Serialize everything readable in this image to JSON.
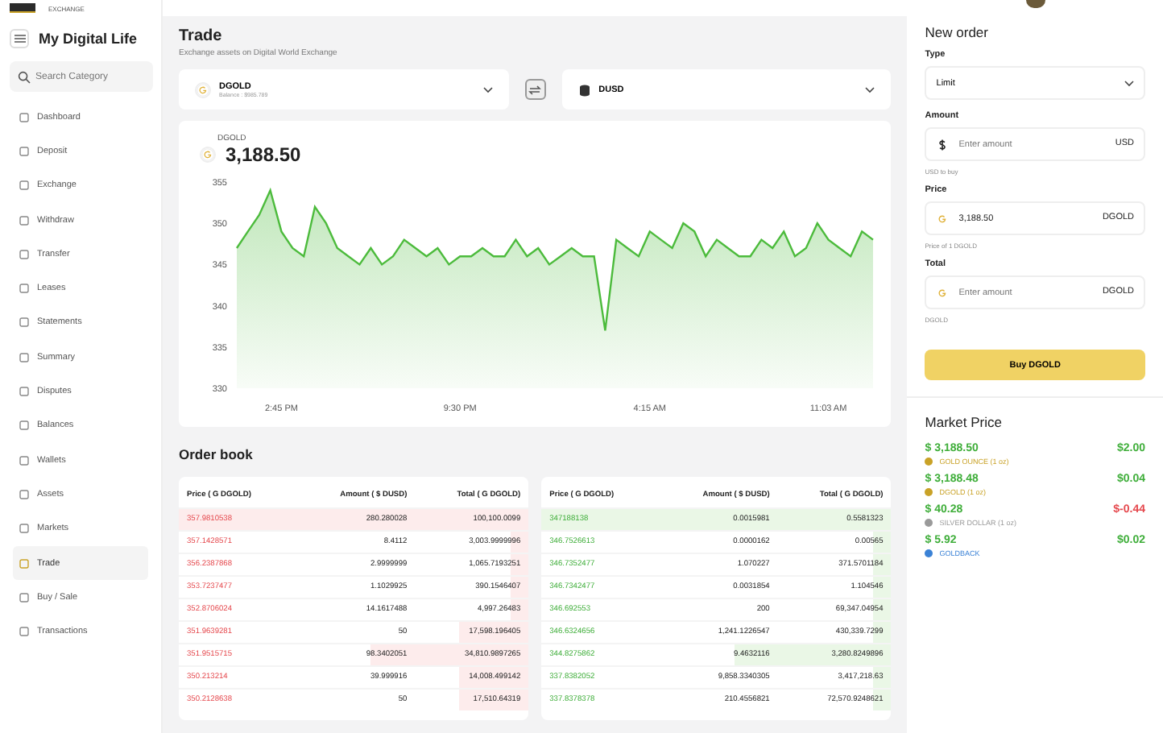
{
  "brand": {
    "tagline": "EXCHANGE"
  },
  "sidebar": {
    "title": "My Digital Life",
    "search": {
      "placeholder": "Search Category"
    },
    "items": [
      {
        "label": "Dashboard",
        "selected": false
      },
      {
        "label": "Deposit",
        "selected": false
      },
      {
        "label": "Exchange",
        "selected": false
      },
      {
        "label": "Withdraw",
        "selected": false
      },
      {
        "label": "Transfer",
        "selected": false
      },
      {
        "label": "Leases",
        "selected": false
      },
      {
        "label": "Statements",
        "selected": false
      },
      {
        "label": "Summary",
        "selected": false
      },
      {
        "label": "Disputes",
        "selected": false
      },
      {
        "label": "Balances",
        "selected": false
      },
      {
        "label": "Wallets",
        "selected": false
      },
      {
        "label": "Assets",
        "selected": false
      },
      {
        "label": "Markets",
        "selected": false
      },
      {
        "label": "Trade",
        "selected": true
      },
      {
        "label": "Buy / Sale",
        "selected": false
      },
      {
        "label": "Transactions",
        "selected": false
      }
    ]
  },
  "trade": {
    "title": "Trade",
    "subtitle": "Exchange assets on Digital World Exchange",
    "from_asset": {
      "name": "DGOLD",
      "balance": "Balance : $985.789"
    },
    "to_asset": {
      "name": "DUSD"
    },
    "chart": {
      "asset": "DGOLD",
      "price": "3,188.50",
      "chart_data": {
        "type": "area",
        "categories": [
          null,
          null,
          null,
          null,
          "2:45 PM",
          null,
          null,
          null,
          null,
          null,
          null,
          null,
          null,
          null,
          null,
          null,
          null,
          null,
          null,
          null,
          "9:30 PM",
          null,
          null,
          null,
          null,
          null,
          null,
          null,
          null,
          null,
          null,
          null,
          null,
          null,
          null,
          null,
          null,
          "4:15 AM",
          null,
          null,
          null,
          null,
          null,
          null,
          null,
          null,
          null,
          null,
          null,
          null,
          null,
          null,
          null,
          "11:03 AM",
          null,
          null,
          null,
          null
        ],
        "series": [
          {
            "color": "#4cbb3c",
            "values": [
              347,
              349,
              351,
              354,
              349,
              347,
              346,
              352,
              350,
              347,
              346,
              345,
              347,
              345,
              346,
              348,
              347,
              346,
              347,
              345,
              346,
              346,
              347,
              346,
              346,
              348,
              346,
              347,
              345,
              346,
              347,
              346,
              346,
              337,
              348,
              347,
              346,
              349,
              348,
              347,
              350,
              349,
              346,
              348,
              347,
              346,
              346,
              348,
              347,
              349,
              346,
              347,
              350,
              348,
              347,
              346,
              349,
              348
            ]
          }
        ],
        "ylim": [
          330,
          355
        ],
        "yticks": [
          330,
          335,
          340,
          345,
          350,
          355
        ]
      }
    }
  },
  "order_book": {
    "title": "Order book",
    "sell": {
      "columns": [
        "Price ( G DGOLD)",
        "Amount ( $ DUSD)",
        "Total ( G DGOLD)"
      ],
      "rows": [
        {
          "price": "357.9810538",
          "amount": "280.280028",
          "total": "100,100.0099",
          "level": 1
        },
        {
          "price": "357.1428571",
          "amount": "8.4112",
          "total": "3,003.9999996",
          "level": 0.05
        },
        {
          "price": "356.2387868",
          "amount": "2.9999999",
          "total": "1,065.7193251",
          "level": 0.05
        },
        {
          "price": "353.7237477",
          "amount": "1.1029925",
          "total": "390.1546407",
          "level": 0.05
        },
        {
          "price": "352.8706024",
          "amount": "14.1617488",
          "total": "4,997.26483",
          "level": 0.05
        },
        {
          "price": "351.9639281",
          "amount": "50",
          "total": "17,598.196405",
          "level": 0.2
        },
        {
          "price": "351.9515715",
          "amount": "98.3402051",
          "total": "34,810.9897265",
          "level": 0.45
        },
        {
          "price": "350.213214",
          "amount": "39.999916",
          "total": "14,008.499142",
          "level": 0.2
        },
        {
          "price": "350.2128638",
          "amount": "50",
          "total": "17,510.64319",
          "level": 0.2
        }
      ]
    },
    "buy": {
      "columns": [
        "Price ( G DGOLD)",
        "Amount ( $ DUSD)",
        "Total ( G DGOLD)"
      ],
      "rows": [
        {
          "price": "347188138",
          "amount": "0.0015981",
          "total": "0.5581323",
          "level": 1
        },
        {
          "price": "346.7526613",
          "amount": "0.0000162",
          "total": "0.00565",
          "level": 0.05
        },
        {
          "price": "346.7352477",
          "amount": "1.070227",
          "total": "371.5701184",
          "level": 0.05
        },
        {
          "price": "346.7342477",
          "amount": "0.0031854",
          "total": "1.104546",
          "level": 0.05
        },
        {
          "price": "346.692553",
          "amount": "200",
          "total": "69,347.04954",
          "level": 0.05
        },
        {
          "price": "346.6324656",
          "amount": "1,241.1226547",
          "total": "430,339.7299",
          "level": 0.05
        },
        {
          "price": "344.8275862",
          "amount": "9.4632116",
          "total": "3,280.8249896",
          "level": 0.45
        },
        {
          "price": "337.8382052",
          "amount": "9,858.3340305",
          "total": "3,417,218.63",
          "level": 0.05
        },
        {
          "price": "337.8378378",
          "amount": "210.4556821",
          "total": "72,570.9248621",
          "level": 0.05
        }
      ]
    }
  },
  "new_order": {
    "title": "New order",
    "type": {
      "label": "Type",
      "value": "Limit"
    },
    "amount": {
      "label": "Amount",
      "placeholder": "Enter amount",
      "unit": "USD",
      "hint": "USD to buy"
    },
    "price": {
      "label": "Price",
      "value": "3,188.50",
      "unit": "DGOLD",
      "hint": "Price of 1 DGOLD"
    },
    "total": {
      "label": "Total",
      "placeholder": "Enter amount",
      "unit": "DGOLD",
      "hint": "DGOLD"
    },
    "button": "Buy DGOLD"
  },
  "market_price": {
    "title": "Market Price",
    "items": [
      {
        "price": "$ 3,188.50",
        "change": "$2.00",
        "kind": "up",
        "name": "GOLD OUNCE (1 oz)",
        "color": "#c9a227"
      },
      {
        "price": "$ 3,188.48",
        "change": "$0.04",
        "kind": "up",
        "name": "DGOLD (1 oz)",
        "color": "#c9a227"
      },
      {
        "price": "$ 40.28",
        "change": "$-0.44",
        "kind": "down",
        "name": "SILVER DOLLAR (1 oz)",
        "color": "#9a9a9a"
      },
      {
        "price": "$ 5.92",
        "change": "$0.02",
        "kind": "up",
        "name": "GOLDBACK",
        "color": "#3b82d6"
      }
    ]
  }
}
